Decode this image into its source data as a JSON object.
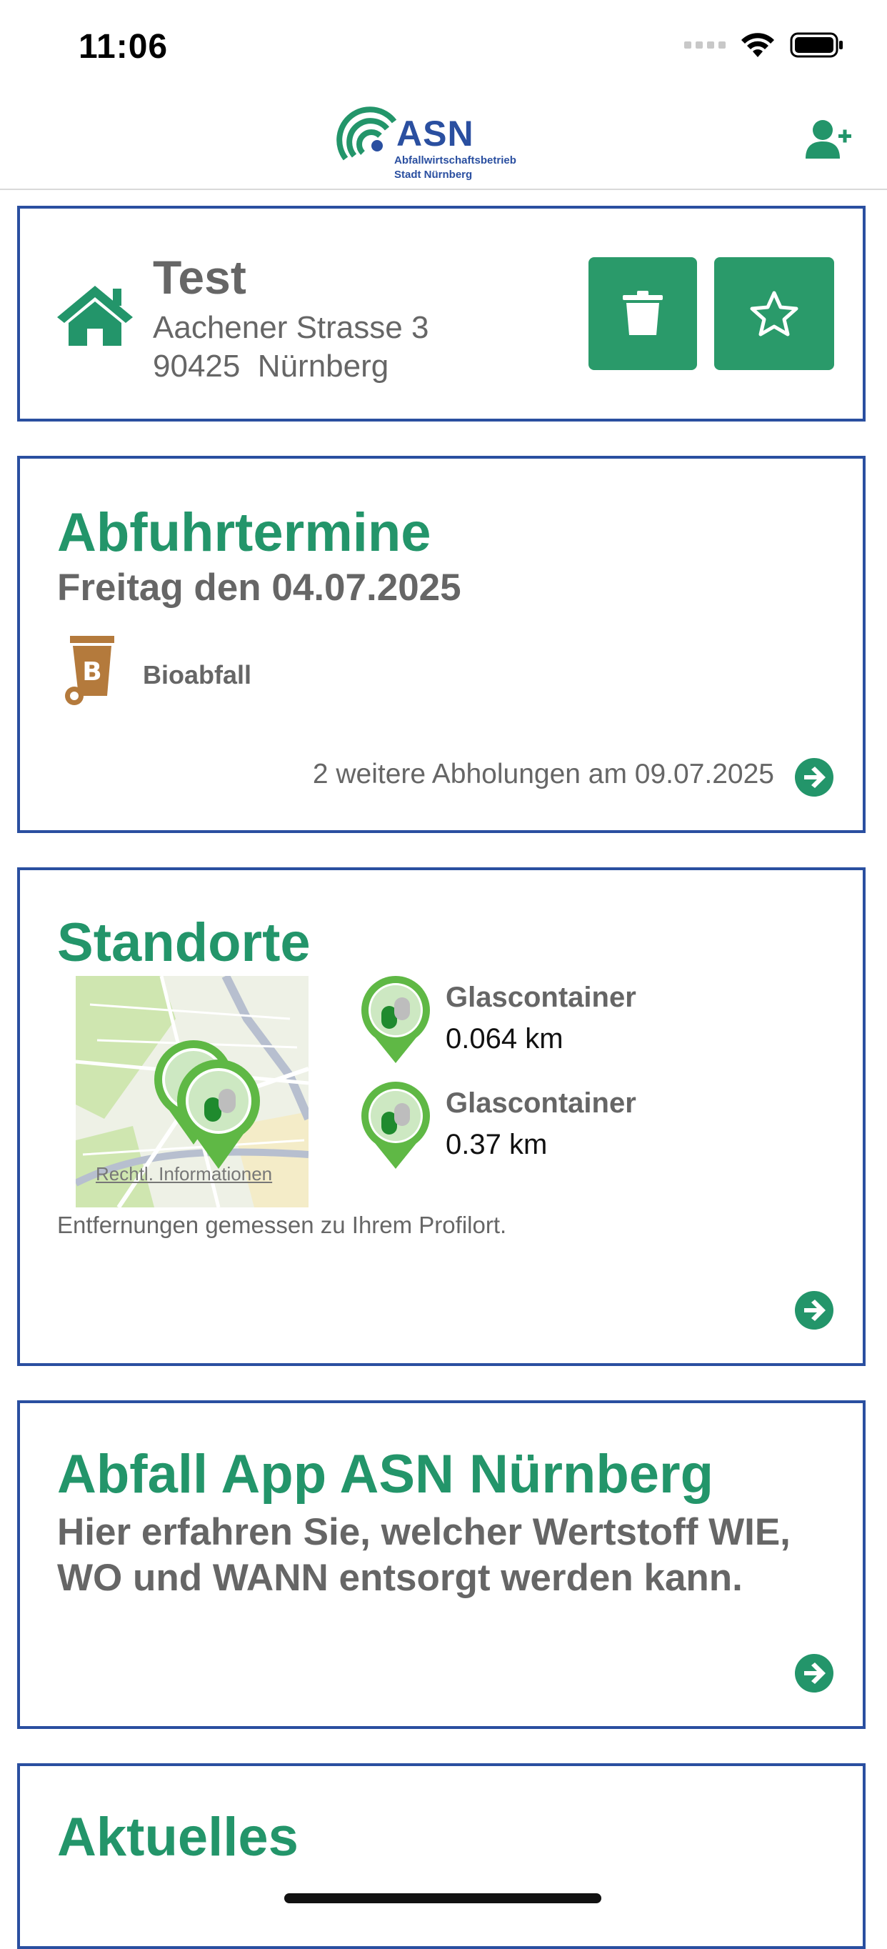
{
  "status_bar": {
    "time": "11:06"
  },
  "header": {
    "logo_title": "ASN",
    "logo_line1": "Abfallwirtschaftsbetrieb",
    "logo_line2": "Stadt Nürnberg"
  },
  "profile": {
    "name": "Test",
    "street": "Aachener Strasse 3",
    "city": "90425  Nürnberg"
  },
  "pickup": {
    "title": "Abfuhrtermine",
    "date": "Freitag den 04.07.2025",
    "bin_letter": "B",
    "bin_label": "Bioabfall",
    "more": "2 weitere Abholungen am 09.07.2025"
  },
  "locations": {
    "title": "Standorte",
    "map_legal": "Rechtl. Informationen",
    "items": [
      {
        "name": "Glascontainer",
        "distance": "0.064 km"
      },
      {
        "name": "Glascontainer",
        "distance": "0.37 km"
      }
    ],
    "note": "Entfernungen gemessen zu Ihrem Profilort."
  },
  "app_info": {
    "title": "Abfall App ASN Nürnberg",
    "line1": "Hier erfahren Sie, welcher Wertstoff WIE,",
    "line2": "WO und WANN entsorgt werden kann."
  },
  "news": {
    "title": "Aktuelles"
  },
  "colors": {
    "accent": "#23956a",
    "border": "#2a4fa0",
    "button": "#2a9a6a",
    "bio_bin": "#b47a3c"
  }
}
